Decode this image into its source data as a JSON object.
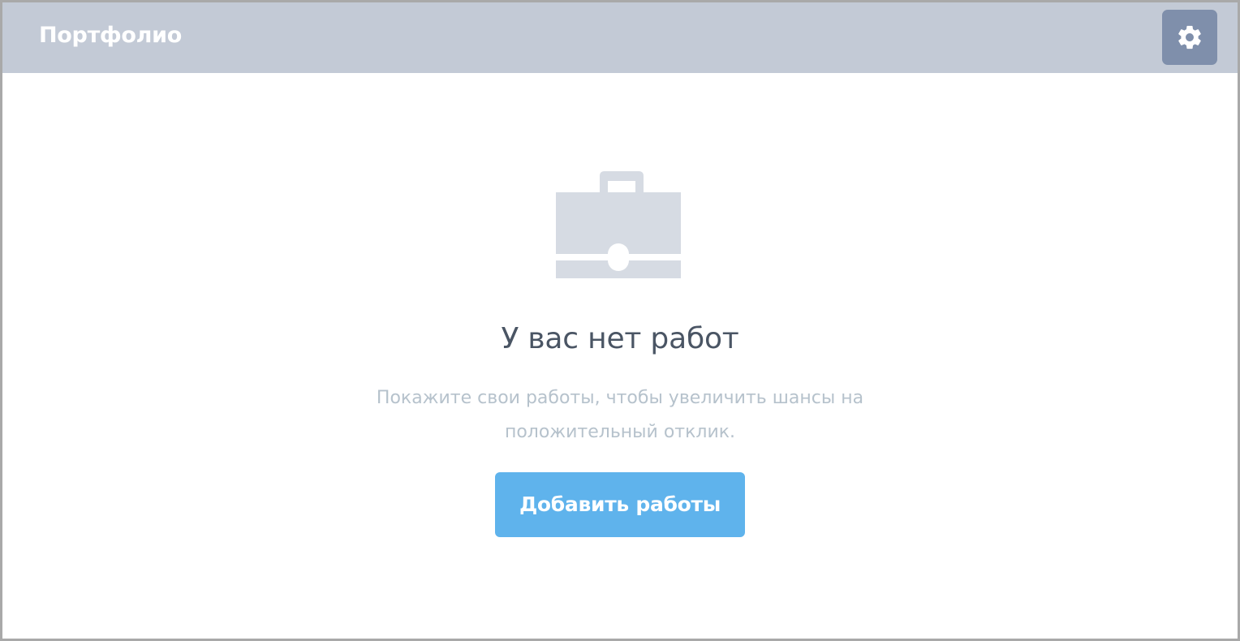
{
  "header": {
    "title": "Портфолио",
    "settings_icon": "gear-icon"
  },
  "empty_state": {
    "icon": "briefcase-icon",
    "title": "У вас нет работ",
    "description_line1": "Покажите свои работы, чтобы увеличить шансы на",
    "description_line2": "положительный отклик.",
    "button_label": "Добавить работы"
  },
  "colors": {
    "header_bg": "#c3cad6",
    "settings_bg": "#7f8fab",
    "button_bg": "#5fb3ec",
    "icon_color": "#d6dbe3",
    "title_color": "#4a5564",
    "description_color": "#b6c2cc"
  }
}
